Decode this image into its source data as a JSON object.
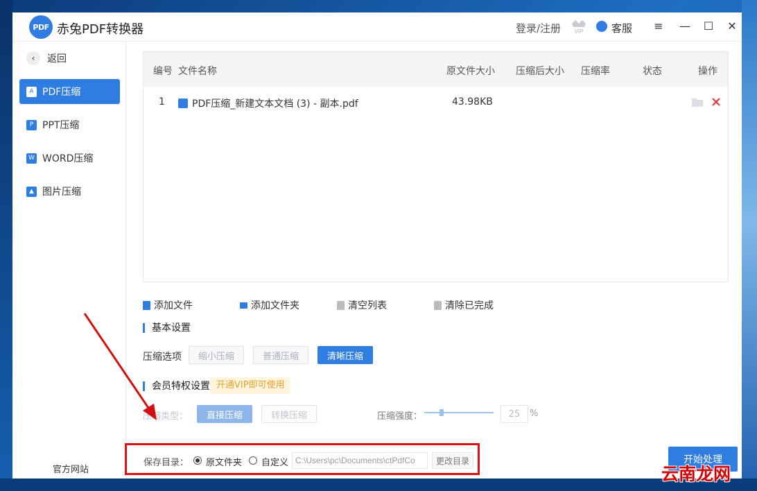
{
  "app": {
    "title": "赤兔PDF转换器",
    "logo_text": "PDF",
    "login": "登录/注册",
    "vip": "VIP",
    "service": "客服"
  },
  "window_controls": {
    "menu": "≡",
    "minimize": "—",
    "maximize": "☐",
    "close": "✕"
  },
  "sidebar": {
    "back": "返回",
    "items": [
      {
        "label": "PDF压缩",
        "active": true
      },
      {
        "label": "PPT压缩",
        "active": false
      },
      {
        "label": "WORD压缩",
        "active": false
      },
      {
        "label": "图片压缩",
        "active": false
      }
    ],
    "official_site": "官方网站"
  },
  "table": {
    "columns": [
      "编号",
      "文件名称",
      "原文件大小",
      "压缩后大小",
      "压缩率",
      "状态",
      "操作"
    ],
    "rows": [
      {
        "index": "1",
        "name": "PDF压缩_新建文本文档 (3) - 副本.pdf",
        "original_size": "43.98KB",
        "compressed_size": "",
        "rate": "",
        "status": ""
      }
    ]
  },
  "actions": {
    "add_file": "添加文件",
    "add_folder": "添加文件夹",
    "clear_list": "清空列表",
    "clear_done": "清除已完成"
  },
  "basic_settings": {
    "title": "基本设置",
    "option_label": "压缩选项",
    "options": [
      "缩小压缩",
      "普通压缩",
      "清晰压缩"
    ],
    "selected": "清晰压缩"
  },
  "vip_settings": {
    "title": "会员特权设置",
    "badge": "开通VIP即可使用",
    "type_label": "压缩类型：",
    "types": [
      "直接压缩",
      "转换压缩"
    ],
    "strength_label": "压缩强度：",
    "strength_value": "25",
    "strength_unit": "%"
  },
  "save": {
    "label": "保存目录：",
    "option_original": "原文件夹",
    "option_custom": "自定义",
    "selected": "原文件夹",
    "path": "C:\\Users\\pc\\Documents\\ctPdfCo",
    "change_button": "更改目录"
  },
  "start_button": "开始处理",
  "watermark": "云南龙网",
  "colors": {
    "accent": "#2f7de0",
    "annotation": "#d11111"
  }
}
